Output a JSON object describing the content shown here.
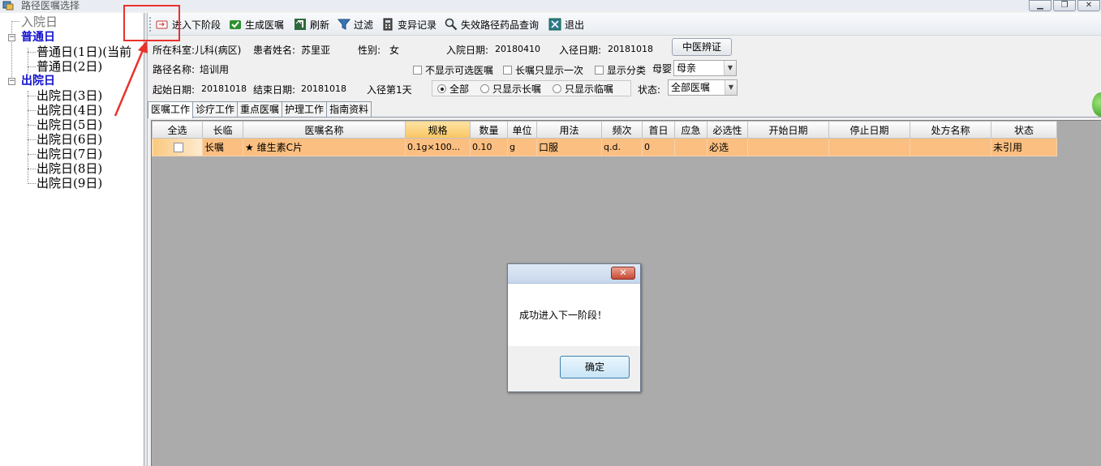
{
  "window": {
    "title": "路径医嘱选择",
    "controls": [
      "minimize",
      "restore",
      "close"
    ]
  },
  "tree": {
    "nodes": [
      {
        "label": "入院日",
        "level": 0,
        "style": "muted"
      },
      {
        "label": "普通日",
        "level": 0,
        "style": "root"
      },
      {
        "label": "普通日(1日)(当前",
        "level": 1
      },
      {
        "label": "普通日(2日)",
        "level": 1
      },
      {
        "label": "出院日",
        "level": 0,
        "style": "root"
      },
      {
        "label": "出院日(3日)",
        "level": 1
      },
      {
        "label": "出院日(4日)",
        "level": 1
      },
      {
        "label": "出院日(5日)",
        "level": 1
      },
      {
        "label": "出院日(6日)",
        "level": 1
      },
      {
        "label": "出院日(7日)",
        "level": 1
      },
      {
        "label": "出院日(8日)",
        "level": 1
      },
      {
        "label": "出院日(9日)",
        "level": 1
      }
    ]
  },
  "toolbar": {
    "items": [
      {
        "label": "进入下阶段",
        "icon": "next-stage-icon"
      },
      {
        "label": "生成医嘱",
        "icon": "generate-orders-icon"
      },
      {
        "label": "刷新",
        "icon": "refresh-icon"
      },
      {
        "label": "过滤",
        "icon": "filter-icon"
      },
      {
        "label": "变异记录",
        "icon": "variance-record-icon"
      },
      {
        "label": "失效路径药品查询",
        "icon": "search-drug-icon"
      },
      {
        "label": "退出",
        "icon": "exit-icon"
      }
    ]
  },
  "info": {
    "dept_label": "所在科室:",
    "dept_value": "儿科(病区)",
    "patient_label": "患者姓名:",
    "patient_value": "苏里亚",
    "gender_label": "性别:",
    "gender_value": "女",
    "admit_label": "入院日期:",
    "admit_value": "20180410",
    "path_in_label": "入径日期:",
    "path_in_value": "20181018",
    "tcm_button": "中医辨证",
    "path_name_label": "路径名称:",
    "path_name_value": "培训用",
    "chk_hide_optional": "不显示可选医嘱",
    "chk_long_once": "长嘱只显示一次",
    "chk_show_category": "显示分类",
    "mother_infant_label": "母婴",
    "mother_infant_value": "母亲",
    "start_label": "起始日期:",
    "start_value": "20181018",
    "end_label": "结束日期:",
    "end_value": "20181018",
    "path_day": "入径第1天",
    "radio_all": "全部",
    "radio_long": "只显示长嘱",
    "radio_temp": "只显示临嘱",
    "radio_selected": "all",
    "status_label": "状态:",
    "status_value": "全部医嘱"
  },
  "tabs": [
    "医嘱工作",
    "诊疗工作",
    "重点医嘱",
    "护理工作",
    "指南资料"
  ],
  "grid": {
    "columns": [
      "全选",
      "长临",
      "医嘱名称",
      "规格",
      "数量",
      "单位",
      "用法",
      "频次",
      "首日",
      "应急",
      "必选性",
      "开始日期",
      "停止日期",
      "处方名称",
      "状态"
    ],
    "selected_column": "规格",
    "rows": [
      {
        "checked": false,
        "type": "长嘱",
        "name": "★ 维生素C片",
        "spec": "0.1g×100...",
        "qty": "0.10",
        "unit": "g",
        "usage": "口服",
        "freq": "q.d.",
        "first_day": "0",
        "urgent": "",
        "required": "必选",
        "start_date": "",
        "stop_date": "",
        "rx_name": "",
        "status": "未引用"
      }
    ]
  },
  "dialog": {
    "message": "成功进入下一阶段！",
    "ok_label": "确定",
    "close_glyph": "✕"
  },
  "colors": {
    "row_highlight": "#fbbf81",
    "annotation_red": "#e8322d",
    "tree_root": "#1010cc"
  }
}
